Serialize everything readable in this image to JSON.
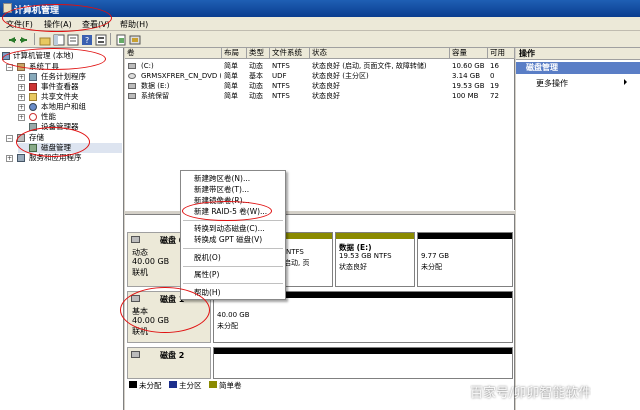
{
  "window": {
    "title": "计算机管理"
  },
  "menubar": {
    "items": [
      "文件(F)",
      "操作(A)",
      "查看(V)",
      "帮助(H)"
    ]
  },
  "tree": {
    "root": "计算机管理 (本地)",
    "system_tools": "系统工具",
    "task_scheduler": "任务计划程序",
    "event_viewer": "事件查看器",
    "shared_folders": "共享文件夹",
    "local_users": "本地用户和组",
    "performance": "性能",
    "device_manager": "设备管理器",
    "storage": "存储",
    "disk_management": "磁盘管理",
    "services": "服务和应用程序"
  },
  "volume_list": {
    "columns": [
      "卷",
      "布局",
      "类型",
      "文件系统",
      "状态",
      "容量",
      "可用"
    ],
    "rows": [
      [
        "(C:)",
        "简单",
        "动态",
        "NTFS",
        "状态良好 (启动, 页面文件, 故障转储)",
        "10.60 GB",
        "16"
      ],
      [
        "GRMSXFRER_CN_DVD (D:)",
        "简单",
        "基本",
        "UDF",
        "状态良好 (主分区)",
        "3.14 GB",
        "0"
      ],
      [
        "数据 (E:)",
        "简单",
        "动态",
        "NTFS",
        "状态良好",
        "19.53 GB",
        "19"
      ],
      [
        "系统保留",
        "简单",
        "动态",
        "NTFS",
        "状态良好",
        "100 MB",
        "72"
      ]
    ]
  },
  "disks": {
    "disk0": {
      "name": "磁盘 0",
      "type": "动态",
      "size": "40.00 GB",
      "status": "联机"
    },
    "disk0_parts": {
      "p1_info": "NTFS",
      "p1_status": "启动, 页",
      "data_name": "数据  (E:)",
      "data_info": "19.53 GB NTFS",
      "data_status": "状态良好",
      "free_size": "9.77 GB",
      "free_status": "未分配"
    },
    "disk1": {
      "name": "磁盘 1",
      "type": "基本",
      "size": "40.00 GB",
      "status": "联机"
    },
    "disk1_parts": {
      "size": "40.00 GB",
      "status": "未分配"
    },
    "disk2": {
      "name": "磁盘 2"
    }
  },
  "legend": {
    "unallocated": "未分配",
    "primary": "主分区",
    "simple": "简单卷"
  },
  "actions": {
    "header": "操作",
    "section": "磁盘管理",
    "more": "更多操作"
  },
  "context_menu": {
    "items": [
      "新建跨区卷(N)...",
      "新建带区卷(T)...",
      "新建镜像卷(R)...",
      "新建 RAID-5 卷(W)...",
      "转换到动态磁盘(C)...",
      "转换成 GPT 磁盘(V)",
      "脱机(O)",
      "属性(P)",
      "帮助(H)"
    ]
  },
  "watermark": "百家号/卯卯智能软件",
  "colors": {
    "unallocated": "#000000",
    "primary": "#1c2e8c",
    "simple": "#8a8a00",
    "accent": "#5a7ec6"
  }
}
